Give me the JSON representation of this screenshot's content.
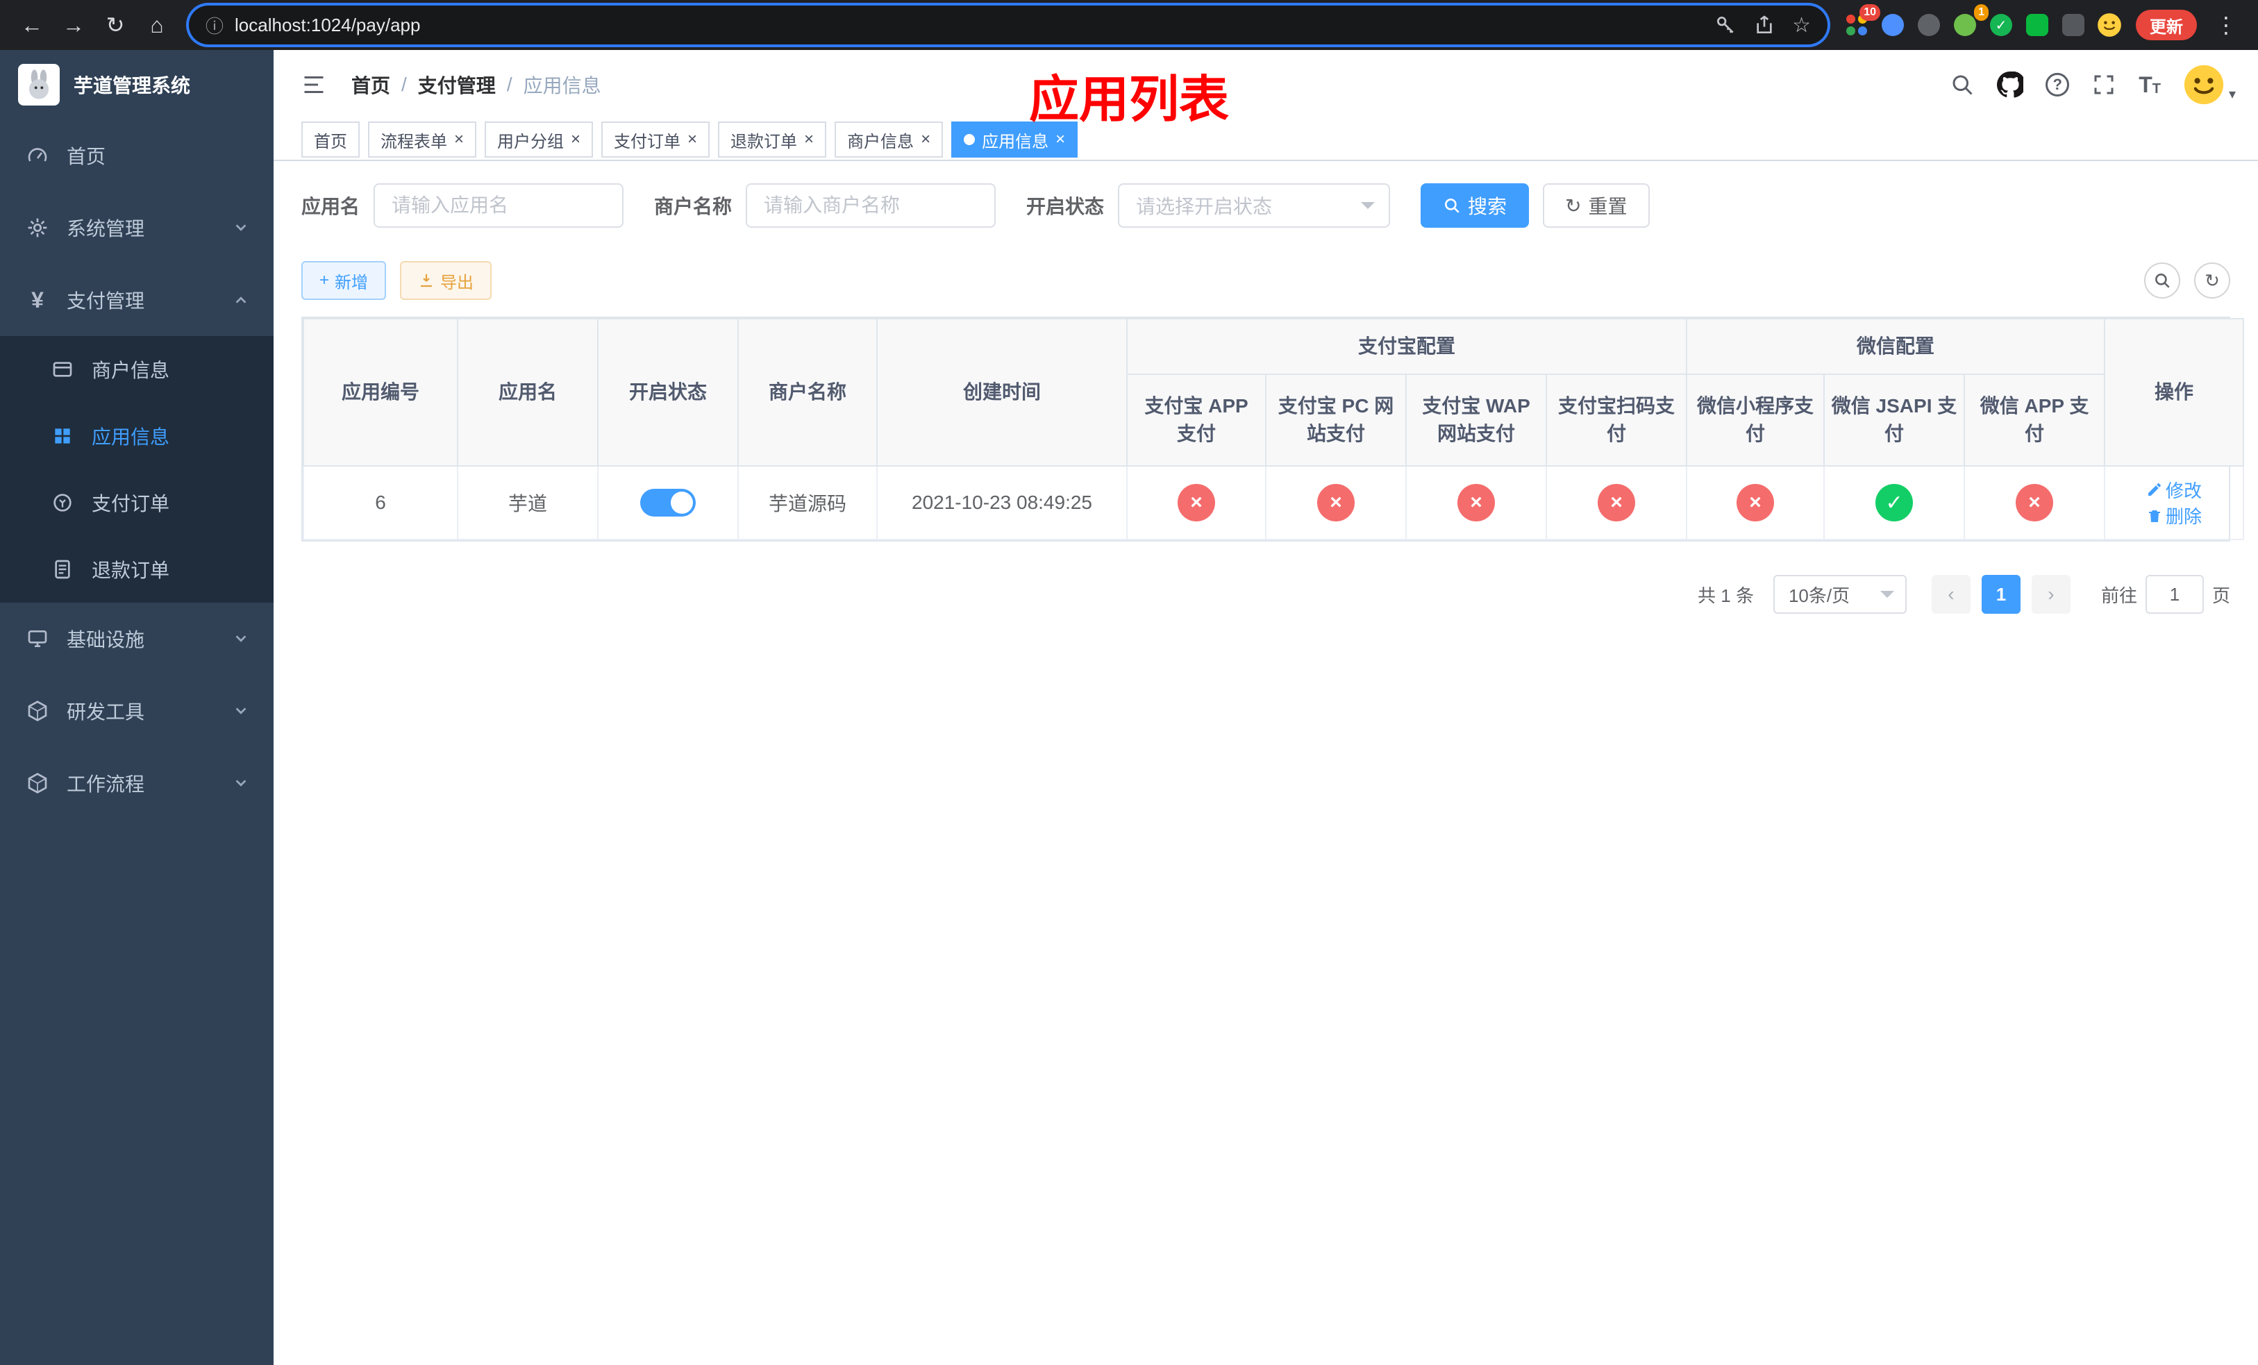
{
  "glyphs": {
    "back": "←",
    "forward": "→",
    "reload": "↻",
    "home": "⌂",
    "info": "ⓘ",
    "star": "☆",
    "dots": "⋮",
    "close": "×",
    "check": "✓",
    "cross": "×",
    "plus": "+",
    "refresh": "↻",
    "caret": "▾",
    "prev": "‹",
    "next": "›",
    "yen": "¥",
    "question": "?",
    "font_big": "T",
    "font_small": "T"
  },
  "browser": {
    "url": "localhost:1024/pay/app",
    "update_button": "更新",
    "extension_badge_1": "10",
    "extension_badge_2": "1"
  },
  "sidebar": {
    "app_title": "芋道管理系统",
    "menu": [
      {
        "label": "首页"
      },
      {
        "label": "系统管理"
      },
      {
        "label": "支付管理"
      },
      {
        "label": "基础设施"
      },
      {
        "label": "研发工具"
      },
      {
        "label": "工作流程"
      }
    ],
    "pay_submenu": [
      {
        "label": "商户信息"
      },
      {
        "label": "应用信息"
      },
      {
        "label": "支付订单"
      },
      {
        "label": "退款订单"
      }
    ]
  },
  "header": {
    "breadcrumb": [
      "首页",
      "支付管理",
      "应用信息"
    ],
    "breadcrumb_separator": "/",
    "overlay_title": "应用列表"
  },
  "tabs": [
    {
      "label": "首页"
    },
    {
      "label": "流程表单"
    },
    {
      "label": "用户分组"
    },
    {
      "label": "支付订单"
    },
    {
      "label": "退款订单"
    },
    {
      "label": "商户信息"
    },
    {
      "label": "应用信息"
    }
  ],
  "filters": {
    "app_name_label": "应用名",
    "app_name_placeholder": "请输入应用名",
    "merchant_label": "商户名称",
    "merchant_placeholder": "请输入商户名称",
    "status_label": "开启状态",
    "status_placeholder": "请选择开启状态",
    "search_button": "搜索",
    "reset_button": "重置"
  },
  "toolbar": {
    "add_button": "新增",
    "export_button": "导出"
  },
  "table": {
    "fixed_columns": [
      "应用编号",
      "应用名",
      "开启状态",
      "商户名称",
      "创建时间"
    ],
    "alipay_group": {
      "label": "支付宝配置",
      "columns": [
        "支付宝 APP 支付",
        "支付宝 PC 网站支付",
        "支付宝 WAP 网站支付",
        "支付宝扫码支付"
      ]
    },
    "wechat_group": {
      "label": "微信配置",
      "columns": [
        "微信小程序支付",
        "微信 JSAPI 支付",
        "微信 APP 支付"
      ]
    },
    "op_column": "操作",
    "row": {
      "app_id": "6",
      "app_name": "芋道",
      "enabled": true,
      "merchant_name": "芋道源码",
      "create_time": "2021-10-23 08:49:25",
      "alipay_app": false,
      "alipay_pc": false,
      "alipay_wap": false,
      "alipay_qr": false,
      "wechat_mini": false,
      "wechat_jsapi": true,
      "wechat_app": false,
      "edit_label": "修改",
      "delete_label": "删除"
    }
  },
  "pagination": {
    "total_text": "共 1 条",
    "page_size": "10条/页",
    "current_page": "1",
    "goto_label": "前往",
    "goto_value": "1",
    "unit_label": "页"
  },
  "colors": {
    "primary": "#409eff",
    "success": "#13ce66",
    "danger": "#f56c6c",
    "warning": "#e6a23c",
    "sidebar_bg": "#304156",
    "submenu_bg": "#1f2d3d",
    "title_red": "#ff0000"
  }
}
